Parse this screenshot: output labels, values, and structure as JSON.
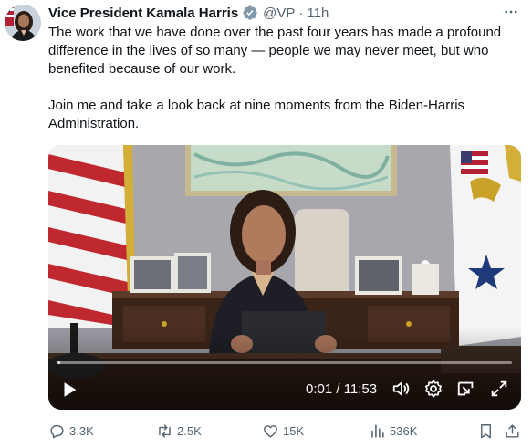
{
  "tweet": {
    "author": {
      "display_name": "Vice President Kamala Harris",
      "handle": "@VP",
      "separator": "·",
      "time": "11h"
    },
    "text": {
      "paragraph_1": "The work that we have done over the past four years has made a profound difference in the lives of so many — people we may never meet, but who benefited because of our work.",
      "paragraph_2": "Join me and take a look back at nine moments from the Biden-Harris Administration."
    },
    "video": {
      "time_display": "0:01 / 11:53",
      "progress_fraction": 0.0014
    },
    "stats": {
      "replies": "3.3K",
      "reposts": "2.5K",
      "likes": "15K",
      "views": "536K"
    }
  },
  "colors": {
    "text_primary": "#0f1419",
    "text_secondary": "#536471",
    "verified_badge": "#829aab"
  },
  "icons": [
    "verified-badge-icon",
    "more-icon",
    "play-icon",
    "volume-icon",
    "settings-icon",
    "pip-icon",
    "fullscreen-icon",
    "reply-icon",
    "repost-icon",
    "like-icon",
    "views-icon",
    "bookmark-icon",
    "share-icon"
  ]
}
